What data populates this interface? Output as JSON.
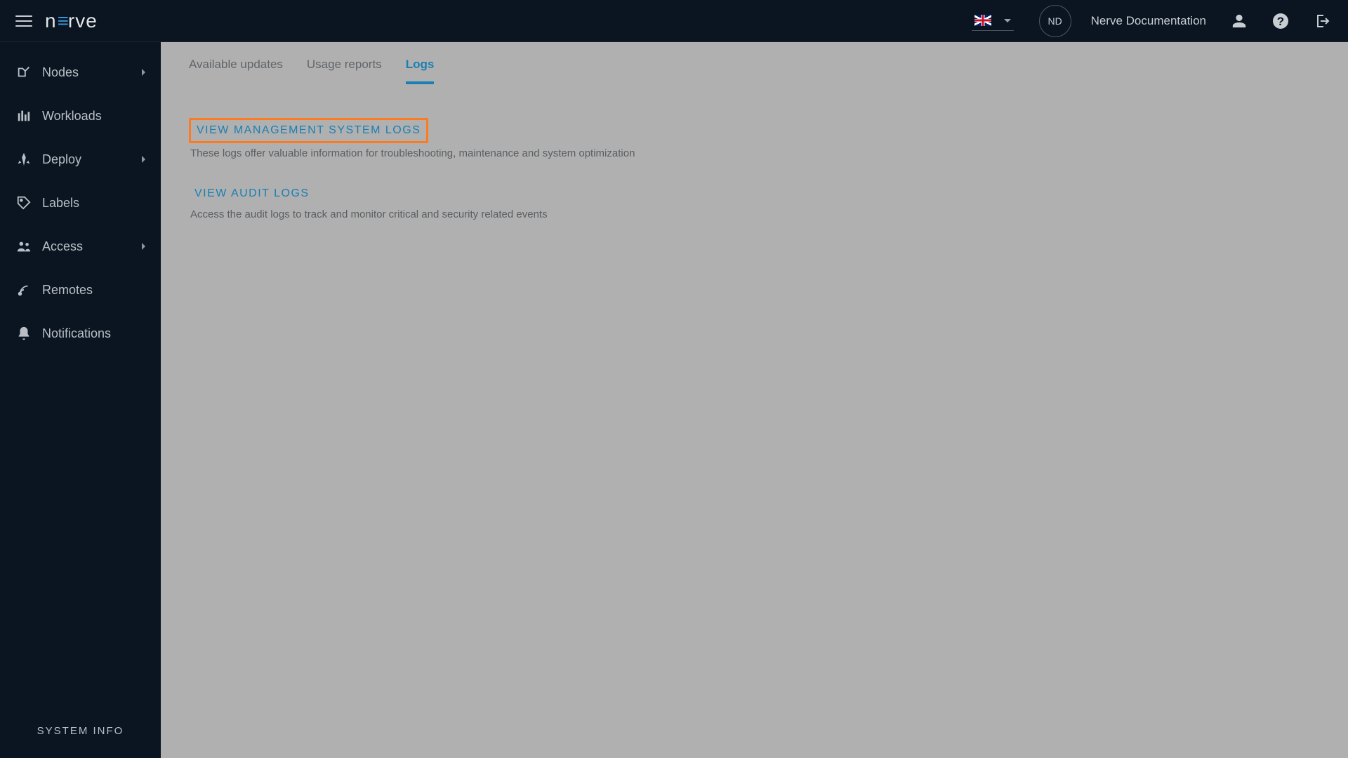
{
  "header": {
    "avatar_initials": "ND",
    "doc_link": "Nerve Documentation"
  },
  "sidebar": {
    "items": [
      {
        "label": "Nodes",
        "has_submenu": true
      },
      {
        "label": "Workloads",
        "has_submenu": false
      },
      {
        "label": "Deploy",
        "has_submenu": true
      },
      {
        "label": "Labels",
        "has_submenu": false
      },
      {
        "label": "Access",
        "has_submenu": true
      },
      {
        "label": "Remotes",
        "has_submenu": false
      },
      {
        "label": "Notifications",
        "has_submenu": false
      }
    ],
    "footer": "SYSTEM INFO"
  },
  "tabs": [
    {
      "label": "Available updates",
      "active": false
    },
    {
      "label": "Usage reports",
      "active": false
    },
    {
      "label": "Logs",
      "active": true
    }
  ],
  "logs": {
    "mgmt": {
      "title": "VIEW MANAGEMENT SYSTEM LOGS",
      "desc": "These logs offer valuable information for troubleshooting, maintenance and system optimization"
    },
    "audit": {
      "title": "VIEW AUDIT LOGS",
      "desc": "Access the audit logs to track and monitor critical and security related events"
    }
  }
}
